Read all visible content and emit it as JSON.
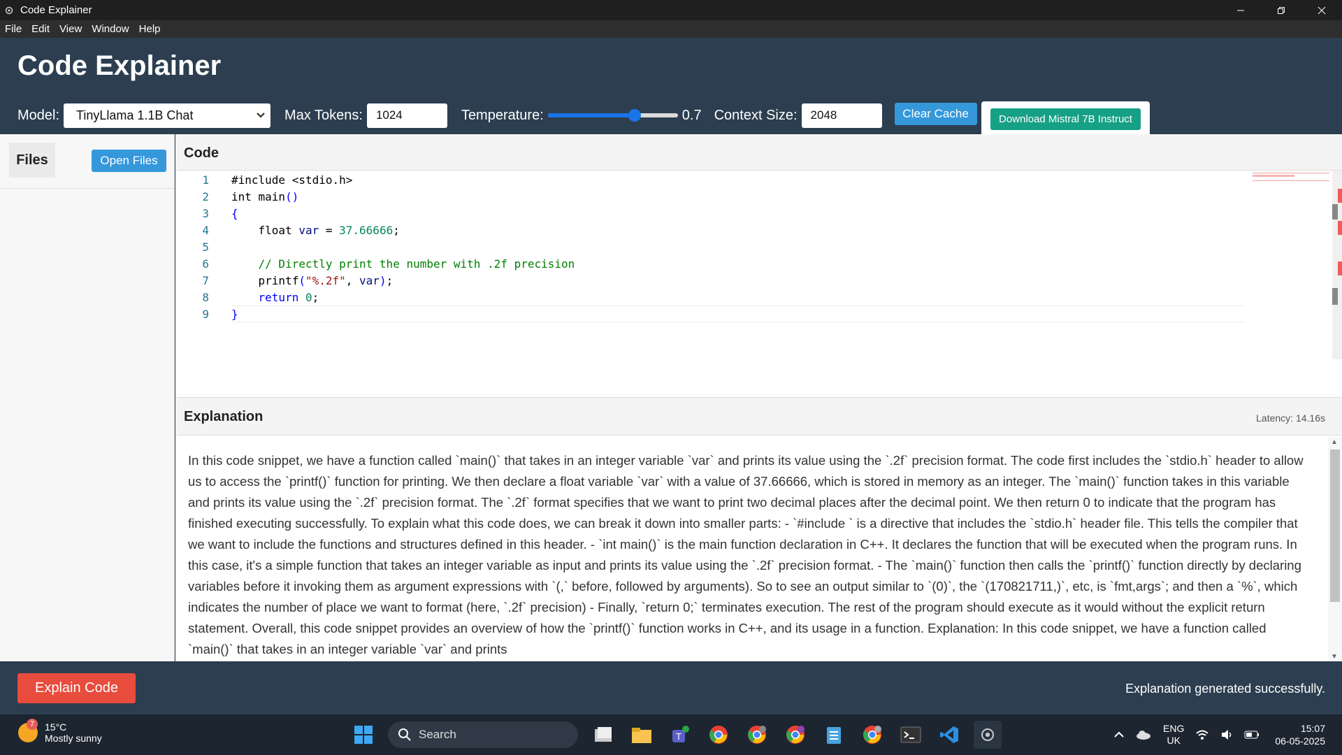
{
  "window": {
    "title": "Code Explainer"
  },
  "menu": [
    "File",
    "Edit",
    "View",
    "Window",
    "Help"
  ],
  "header": {
    "app_title": "Code Explainer",
    "model_label": "Model:",
    "model_value": "TinyLlama 1.1B Chat",
    "max_tokens_label": "Max Tokens:",
    "max_tokens_value": "1024",
    "temperature_label": "Temperature:",
    "temperature_value": "0.7",
    "temperature_fraction": 0.67,
    "context_label": "Context Size:",
    "context_value": "2048",
    "clear_cache": "Clear Cache",
    "download_button": "Download Mistral 7B Instruct"
  },
  "sidebar": {
    "files_tab": "Files",
    "open_files": "Open Files"
  },
  "code": {
    "title": "Code",
    "line_numbers": [
      "1",
      "2",
      "3",
      "4",
      "5",
      "6",
      "7",
      "8",
      "9"
    ],
    "lines": [
      "#include <stdio.h>",
      "int main()",
      "{",
      "    float var = 37.66666;",
      "",
      "    // Directly print the number with .2f precision",
      "    printf(\"%.2f\", var);",
      "    return 0;",
      "}"
    ]
  },
  "explanation": {
    "title": "Explanation",
    "latency": "Latency: 14.16s",
    "text": "In this code snippet, we have a function called `main()` that takes in an integer variable `var` and prints its value using the `.2f` precision format. The code first includes the `stdio.h` header to allow us to access the `printf()` function for printing. We then declare a float variable `var` with a value of 37.66666, which is stored in memory as an integer. The `main()` function takes in this variable and prints its value using the `.2f` precision format. The `.2f` format specifies that we want to print two decimal places after the decimal point. We then return 0 to indicate that the program has finished executing successfully. To explain what this code does, we can break it down into smaller parts: - `#include ` is a directive that includes the `stdio.h` header file. This tells the compiler that we want to include the functions and structures defined in this header. - `int main()` is the main function declaration in C++. It declares the function that will be executed when the program runs. In this case, it's a simple function that takes an integer variable as input and prints its value using the `.2f` precision format. - The `main()` function then calls the `printf()` function directly by declaring variables before it invoking them as argument expressions with `(,` before, followed by arguments). So to see an output similar to `(0)`, the `(170821711,)`, etc, is `fmt,args`; and then a `%`, which indicates the number of place we want to format (here, `.2f` precision) - Finally, `return 0;` terminates execution. The rest of the program should execute as it would without the explicit return statement. Overall, this code snippet provides an overview of how the `printf()` function works in C++, and its usage in a function. Explanation: In this code snippet, we have a function called `main()` that takes in an integer variable `var` and prints"
  },
  "bottom": {
    "explain_button": "Explain Code",
    "status": "Explanation generated successfully."
  },
  "taskbar": {
    "temp": "15°C",
    "weather": "Mostly sunny",
    "weather_badge": "7",
    "search_placeholder": "Search",
    "lang": "ENG",
    "region": "UK",
    "time": "15:07",
    "date": "06-05-2025"
  },
  "colors": {
    "header_bg": "#2c3e50",
    "blue_button": "#3498db",
    "green_button": "#16a085",
    "red_button": "#e74c3c"
  }
}
